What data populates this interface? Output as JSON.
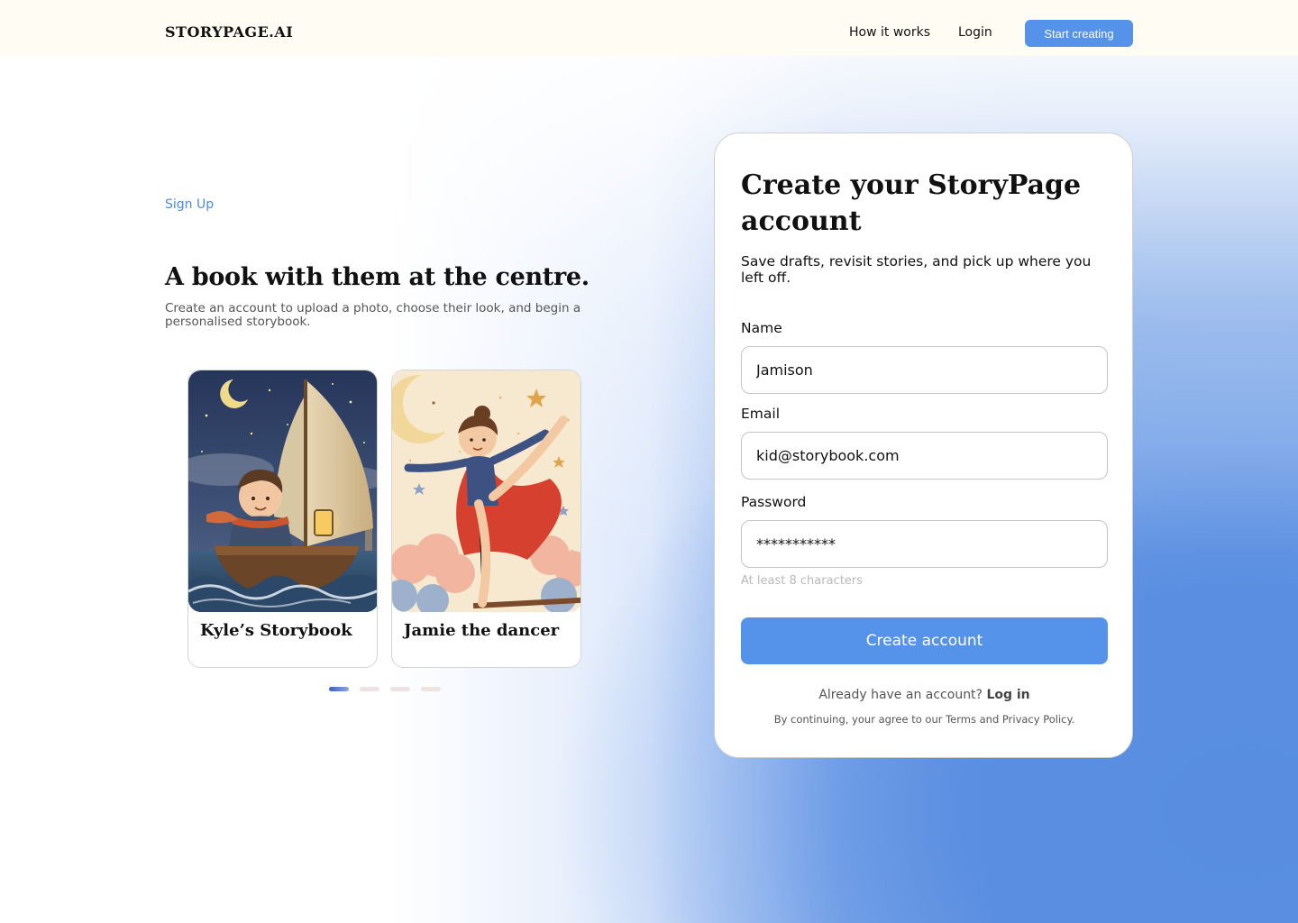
{
  "nav": {
    "logo": "STORYPAGE.AI",
    "how_it_works": "How it works",
    "login": "Login",
    "cta": "Start creating"
  },
  "hero": {
    "eyebrow": "Sign Up",
    "title": "A book with them at the centre.",
    "subtitle": "Create an account to upload a photo, choose their look, and begin a personalised storybook."
  },
  "cards": [
    {
      "title": "Kyle’s Storybook",
      "illustration": "boy-in-sailboat-at-night"
    },
    {
      "title": "Jamie the dancer",
      "illustration": "girl-dancing-with-moon-and-stars"
    }
  ],
  "carousel": {
    "total": 4,
    "active": 1
  },
  "form": {
    "title": "Create your StoryPage account",
    "subtitle": "Save drafts, revisit stories, and pick up where you left off.",
    "name_label": "Name",
    "name_value": "Jamison",
    "email_label": "Email",
    "email_value": "kid@storybook.com",
    "password_label": "Password",
    "password_value": "***********",
    "password_hint": "At least 8 characters",
    "submit": "Create account",
    "already_text": "Already have an account?",
    "login_link": "Log in",
    "terms": "By continuing, your agree to our Terms and Privacy Policy."
  },
  "colors": {
    "accent": "#5592ea",
    "nav_bg": "#fffdf3",
    "eyebrow": "#4a8ae8",
    "gradient_blue": "#6496e2"
  }
}
